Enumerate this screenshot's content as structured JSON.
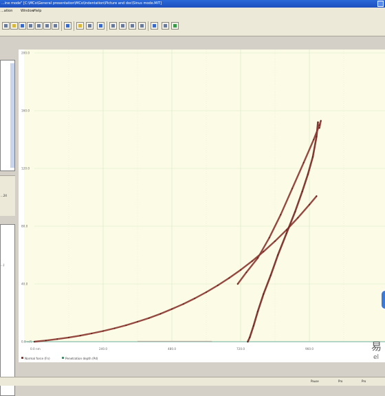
{
  "window": {
    "title": "...ine mode\" [C:\\MCo\\General presentation\\MCo\\Indentation\\Picture and doc\\Sinus mode.MIT]"
  },
  "menu": [
    "...ation",
    "Window",
    "Help"
  ],
  "left_panel": {
    "bar_text": "...24",
    "box_text": "...)"
  },
  "chart_data": {
    "type": "line",
    "xlabel": "",
    "ylabel": "",
    "x_ticks": [
      "0.0 nm",
      "240.0",
      "480.0",
      "720.0",
      "960.0"
    ],
    "y_ticks": [
      "0.0 mN",
      "40.0",
      "80.0",
      "120.0",
      "160.0",
      "200.0"
    ],
    "xlim": [
      0,
      1200
    ],
    "ylim": [
      0,
      200
    ],
    "grid": true,
    "legend": [
      "Normal force (Fn)",
      "Penetration depth (Pd)"
    ],
    "legend_position": "bottom-left",
    "colors": {
      "loading": "#8c3a32",
      "unloading": "#7a2a24",
      "background": "#fcfce6",
      "grid": "#d4e8c4",
      "axis_base": "#9ac8b8"
    },
    "series": [
      {
        "x": [
          0,
          40,
          80,
          120,
          160,
          200,
          240,
          280,
          320,
          360,
          400,
          440,
          480,
          520,
          560,
          600,
          640,
          680,
          720,
          760,
          800,
          840,
          880,
          920,
          960,
          985
        ],
        "y": [
          0,
          0.8,
          1.8,
          2.9,
          4.2,
          5.7,
          7.4,
          9.3,
          11.4,
          13.8,
          16.4,
          19.3,
          22.6,
          26.1,
          30.0,
          34.3,
          39.0,
          44.1,
          49.7,
          55.8,
          62.4,
          69.6,
          77.4,
          85.8,
          94.9,
          100.8
        ]
      },
      {
        "x": [
          990,
          985,
          972,
          955,
          935,
          910,
          880,
          850,
          825,
          800,
          780,
          765,
          752,
          745
        ],
        "y": [
          152,
          142,
          128,
          116,
          104,
          90,
          75,
          60,
          46,
          33,
          21,
          11,
          3,
          0
        ]
      },
      {
        "x": [
          710,
          740,
          780,
          820,
          860,
          900,
          940,
          975,
          995,
          1000,
          995
        ],
        "y": [
          40,
          48,
          58,
          72,
          88,
          106,
          124,
          140,
          150,
          153,
          148
        ]
      }
    ]
  },
  "status": [
    "Pause",
    "Pro",
    "Pro"
  ],
  "watermark": {
    "line1": "易",
    "line2": "el"
  }
}
